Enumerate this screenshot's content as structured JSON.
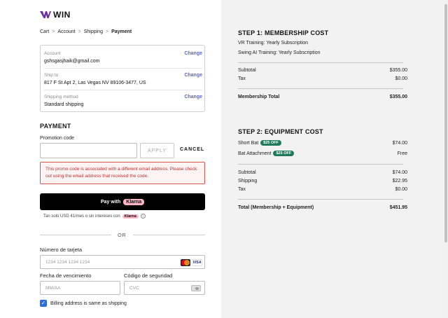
{
  "brand": {
    "name": "WIN",
    "mark_color": "#6b2fa3"
  },
  "breadcrumb": {
    "items": [
      "Cart",
      "Account",
      "Shipping"
    ],
    "current": "Payment",
    "separator": ">"
  },
  "info": {
    "account": {
      "label": "Account",
      "value": "gshsgasjhaik@gmail.com",
      "change": "Change"
    },
    "ship_to": {
      "label": "Ship to",
      "value": "817 F St Apt 2, Las Vegas NV 89106-3477, US",
      "change": "Change"
    },
    "shipping_method": {
      "label": "Shipping method",
      "value": "Standard shipping",
      "change": "Change"
    }
  },
  "payment": {
    "heading": "PAYMENT",
    "promo_label": "Promotion code",
    "promo_value": "",
    "apply_label": "APPLY",
    "cancel_label": "CANCEL",
    "error_text": "This promo code is associated with a different email address. Please check out using the email address that received the code.",
    "klarna_button_prefix": "Pay with",
    "klarna_brand": "Klarna",
    "klarna_note": "Tan solo USD 41/mes o sin intereses con",
    "klarna_mini": "Klarna",
    "info_glyph": "i",
    "or_label": "OR",
    "card_label": "Número de tarjeta",
    "card_placeholder": "1234 1234 1234 1234",
    "visa_label": "VISA",
    "expiry_label": "Fecha de vencimiento",
    "expiry_placeholder": "MM/AA",
    "cvc_label": "Código de seguridad",
    "cvc_placeholder": "CVC",
    "billing_label": "Billing address is same as shipping",
    "billing_checked": true
  },
  "summary": {
    "step1": {
      "heading": "STEP 1: MEMBERSHIP COST",
      "items": [
        "VR Training: Yearly Subscription",
        "Swing AI Training: Yearly Subscription"
      ],
      "subtotal_label": "Subtotal",
      "subtotal": "$355.00",
      "tax_label": "Tax",
      "tax": "$0.00",
      "total_label": "Membership Total",
      "total": "$355.00"
    },
    "step2": {
      "heading": "STEP 2: EQUIPMENT COST",
      "items": [
        {
          "name": "Short Bat",
          "badge": "$25 OFF",
          "price": "$74.00"
        },
        {
          "name": "Bat Attachment",
          "badge": "$25 OFF",
          "price": "Free"
        }
      ],
      "subtotal_label": "Subtotal",
      "subtotal": "$74.00",
      "shipping_label": "Shipping",
      "shipping": "$22.95",
      "tax_label": "Tax",
      "tax": "$0.00",
      "total_label": "Total (Membership + Equipment)",
      "total": "$451.95"
    }
  },
  "colors": {
    "accent_link": "#5b67c9",
    "error": "#c9302c",
    "klarna_pink": "#ffb3c7",
    "badge_green": "#1e7a5b",
    "summary_bg": "#f2f2f2"
  }
}
